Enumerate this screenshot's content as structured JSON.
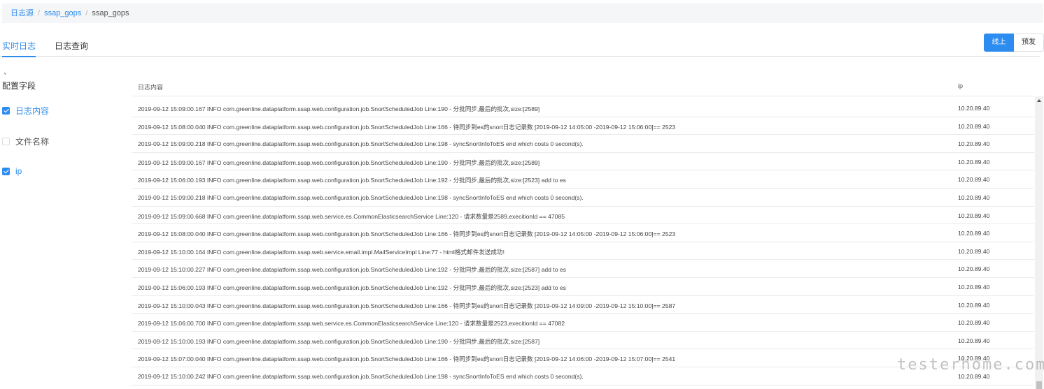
{
  "breadcrumb": {
    "root": "日志源",
    "parent": "ssap_gops",
    "current": "ssap_gops",
    "separator": "/"
  },
  "tabs": {
    "realtime": "实时日志",
    "query": "日志查询"
  },
  "env": {
    "online": "线上",
    "pre": "预发"
  },
  "sidebar": {
    "mark": "、",
    "title": "配置字段",
    "fields": [
      {
        "label": "日志内容",
        "checked": true
      },
      {
        "label": "文件名称",
        "checked": false
      },
      {
        "label": "ip",
        "checked": true
      }
    ]
  },
  "table": {
    "headers": {
      "content": "日志内容",
      "ip": "ip"
    },
    "rows": [
      {
        "content": "2019-09-12 15:09:00.167 INFO com.greenline.dataplatform.ssap.web.configuration.job.SnortScheduledJob Line:190 - 分批同步,最后的批次,size:[2589]",
        "ip": "10.20.89.40"
      },
      {
        "content": "2019-09-12 15:08:00.040 INFO com.greenline.dataplatform.ssap.web.configuration.job.SnortScheduledJob Line:166 - 待同步到es的snort日志记录数 [2019-09-12 14:05:00 -2019-09-12 15:06:00]== 2523",
        "ip": "10.20.89.40"
      },
      {
        "content": "2019-09-12 15:09:00.218 INFO com.greenline.dataplatform.ssap.web.configuration.job.SnortScheduledJob Line:198 - syncSnortInfoToES end which costs 0 second(s).",
        "ip": "10.20.89.40"
      },
      {
        "content": "2019-09-12 15:09:00.167 INFO com.greenline.dataplatform.ssap.web.configuration.job.SnortScheduledJob Line:190 - 分批同步,最后的批次,size:[2589]",
        "ip": "10.20.89.40"
      },
      {
        "content": "2019-09-12 15:06:00.193 INFO com.greenline.dataplatform.ssap.web.configuration.job.SnortScheduledJob Line:192 - 分批同步,最后的批次,size:[2523] add to es",
        "ip": "10.20.89.40"
      },
      {
        "content": "2019-09-12 15:09:00.218 INFO com.greenline.dataplatform.ssap.web.configuration.job.SnortScheduledJob Line:198 - syncSnortInfoToES end which costs 0 second(s).",
        "ip": "10.20.89.40"
      },
      {
        "content": "2019-09-12 15:09:00.668 INFO com.greenline.dataplatform.ssap.web.service.es.CommonElasticsearchService Line:120 - 请求数量是2589,execitionId == 47085",
        "ip": "10.20.89.40"
      },
      {
        "content": "2019-09-12 15:08:00.040 INFO com.greenline.dataplatform.ssap.web.configuration.job.SnortScheduledJob Line:166 - 待同步到es的snort日志记录数 [2019-09-12 14:05:00 -2019-09-12 15:06:00]== 2523",
        "ip": "10.20.89.40"
      },
      {
        "content": "2019-09-12 15:10:00.164 INFO com.greenline.dataplatform.ssap.web.service.email.impl.MailServiceImpl Line:77 - html格式邮件发送成功!",
        "ip": "10.20.89.40"
      },
      {
        "content": "2019-09-12 15:10:00.227 INFO com.greenline.dataplatform.ssap.web.configuration.job.SnortScheduledJob Line:192 - 分批同步,最后的批次,size:[2587] add to es",
        "ip": "10.20.89.40"
      },
      {
        "content": "2019-09-12 15:06:00.193 INFO com.greenline.dataplatform.ssap.web.configuration.job.SnortScheduledJob Line:192 - 分批同步,最后的批次,size:[2523] add to es",
        "ip": "10.20.89.40"
      },
      {
        "content": "2019-09-12 15:10:00.043 INFO com.greenline.dataplatform.ssap.web.configuration.job.SnortScheduledJob Line:166 - 待同步到es的snort日志记录数 [2019-09-12 14:09:00 -2019-09-12 15:10:00]== 2587",
        "ip": "10.20.89.40"
      },
      {
        "content": "2019-09-12 15:06:00.700 INFO com.greenline.dataplatform.ssap.web.service.es.CommonElasticsearchService Line:120 - 请求数量是2523,execitionId == 47082",
        "ip": "10.20.89.40"
      },
      {
        "content": "2019-09-12 15:10:00.193 INFO com.greenline.dataplatform.ssap.web.configuration.job.SnortScheduledJob Line:190 - 分批同步,最后的批次,size:[2587]",
        "ip": "10.20.89.40"
      },
      {
        "content": "2019-09-12 15:07:00.040 INFO com.greenline.dataplatform.ssap.web.configuration.job.SnortScheduledJob Line:166 - 待同步到es的snort日志记录数 [2019-09-12 14:06:00 -2019-09-12 15:07:00]== 2541",
        "ip": "10.20.89.40"
      },
      {
        "content": "2019-09-12 15:10:00.242 INFO com.greenline.dataplatform.ssap.web.configuration.job.SnortScheduledJob Line:198 - syncSnortInfoToES end which costs 0 second(s).",
        "ip": "10.20.89.40"
      }
    ]
  },
  "watermark": "testerhome.com"
}
